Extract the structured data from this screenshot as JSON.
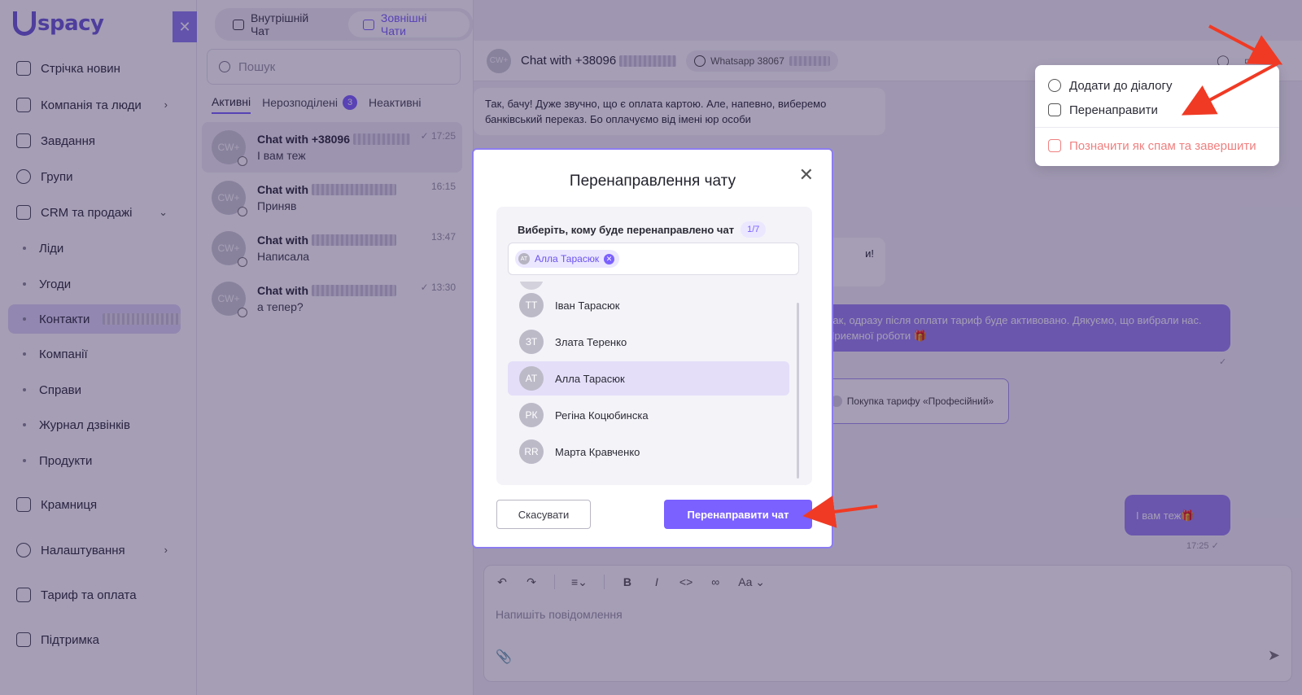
{
  "brand": {
    "logo_text": "spacy",
    "collapse_icon": "close-icon"
  },
  "sidebar": {
    "items": [
      {
        "label": "Стрічка новин",
        "icon": "newspaper-icon"
      },
      {
        "label": "Компанія та люди",
        "icon": "company-icon"
      },
      {
        "label": "Завдання",
        "icon": "calendar-icon"
      },
      {
        "label": "Групи",
        "icon": "people-icon"
      },
      {
        "label": "CRM та продажі",
        "icon": "crm-icon"
      },
      {
        "label": "Ліди"
      },
      {
        "label": "Угоди"
      },
      {
        "label": "Контакти"
      },
      {
        "label": "Компанії"
      },
      {
        "label": "Справи"
      },
      {
        "label": "Журнал дзвінків"
      },
      {
        "label": "Продукти"
      },
      {
        "label": "Крамниця",
        "icon": "shop-icon"
      },
      {
        "label": "Налаштування",
        "icon": "gear-icon"
      },
      {
        "label": "Тариф та оплата",
        "icon": "wallet-icon"
      },
      {
        "label": "Підтримка",
        "icon": "help-icon"
      }
    ]
  },
  "chat_list": {
    "tabs": {
      "internal": "Внутрішній Чат",
      "external": "Зовнішні Чати"
    },
    "search_placeholder": "Пошук",
    "subtabs": {
      "active": "Активні",
      "unassigned": "Нерозподілені",
      "unassigned_count": "3",
      "inactive": "Неактивні"
    },
    "items": [
      {
        "name": "Chat with +38096",
        "preview": "І вам теж",
        "time": "17:25",
        "avatar": "CW+"
      },
      {
        "name": "Chat with",
        "preview": "Приняв",
        "time": "16:15",
        "avatar": "CW+"
      },
      {
        "name": "Chat with",
        "preview": "Написала",
        "time": "13:47",
        "avatar": "CW+"
      },
      {
        "name": "Chat with",
        "preview": "а тепер?",
        "time": "13:30",
        "avatar": "CW+"
      }
    ]
  },
  "conversation": {
    "title": "Chat with +38096",
    "avatar": "CW+",
    "whatsapp_label": "Whatsapp 38067",
    "messages": {
      "in_1": "Так, бачу! Дуже звучно, що є оплата картою. Але, напевно, виберемо банківський переказ. Бо оплачуємо від імені юр особи",
      "in_2_tail": "и!",
      "out_1": "Так, одразу після оплати тариф буде активовано. Дякуємо, що вибрали нас. Приємної роботи",
      "deal": "Покупка тарифу «Професійний»",
      "out_2": "І вам теж",
      "out_2_time": "17:25"
    },
    "composer": {
      "placeholder": "Напишіть повідомлення",
      "font_btn": "Aa"
    }
  },
  "dropdown": {
    "add": "Додати до діалогу",
    "forward": "Перенаправити",
    "spam": "Позначити як спам та завершити"
  },
  "modal": {
    "title": "Перенаправлення чату",
    "select_label": "Виберіть, кому буде перенаправлено чат",
    "counter": "1/7",
    "selected_tag": {
      "initials": "АТ",
      "name": "Алла Тарасюк"
    },
    "people": [
      {
        "initials": "ТТ",
        "name": "Іван Тарасюк"
      },
      {
        "initials": "ЗТ",
        "name": "Злата Теренко"
      },
      {
        "initials": "АТ",
        "name": "Алла Тарасюк"
      },
      {
        "initials": "РК",
        "name": "Регіна Коцюбинска"
      },
      {
        "initials": "RR",
        "name": "Марта Кравченко"
      }
    ],
    "cancel": "Скасувати",
    "submit": "Перенаправити чат"
  },
  "colors": {
    "accent": "#7b61ff",
    "overlay": "rgba(40,24,78,0.42)",
    "annotation": "#f03a24",
    "danger": "#f08080"
  }
}
